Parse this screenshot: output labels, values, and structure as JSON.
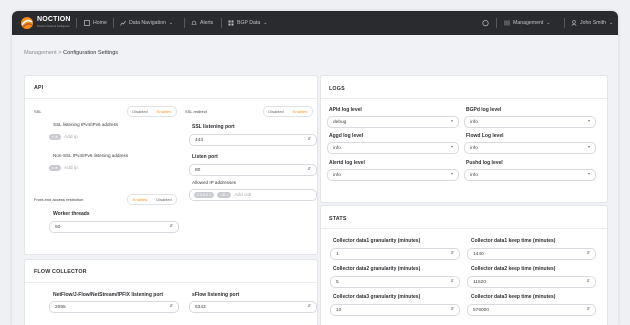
{
  "brand": {
    "name": "NOCTION",
    "tagline": "Noction Network Intelligence"
  },
  "nav": {
    "home": "Home",
    "data_navigation": "Data Navigation",
    "alerts": "Alerts",
    "bgp_data": "BGP Data",
    "management": "Management",
    "user": "John Smith"
  },
  "breadcrumb": {
    "parent": "Management",
    "separator": ">",
    "current": "Configuration Settings"
  },
  "api": {
    "title": "API",
    "ssl_label": "SSL",
    "ssl_off": "Disabled",
    "ssl_on": "Enabled",
    "ssl_redirect_label": "SSL redirect",
    "redirect_off": "Disabled",
    "redirect_on": "Enabled",
    "ssl_listen_label": "SSL listening IPv4/IPv6 address",
    "ssl_listen_chip": "x ★",
    "ssl_listen_placeholder": "Add ip",
    "ssl_port_label": "SSL listening port",
    "ssl_port_value": "443",
    "nonssl_listen_label": "Non-SSL IPv4/IPv6 listening address",
    "nonssl_listen_chip": "x ★",
    "nonssl_listen_placeholder": "Add ip",
    "listen_port_label": "Listen port",
    "listen_port_value": "80",
    "allowed_label": "Allowed IP addresses",
    "allowed_chip1": "0.0.0.0 ×",
    "allowed_chip2": "::/0 ×",
    "allowed_placeholder": "Add cidr",
    "frontend_label": "Front-end access restriction",
    "frontend_on": "Enabled",
    "frontend_off": "Disabled",
    "workers_label": "Worker threads",
    "workers_value": "50"
  },
  "flow": {
    "title": "FLOW COLLECTOR",
    "netflow_label": "NetFlow/J-Flow/NetStream/IPFIX listening port",
    "netflow_value": "2055",
    "sflow_label": "sFlow listening port",
    "sflow_value": "6343"
  },
  "logs": {
    "title": "LOGS",
    "apid_label": "APId log level",
    "apid_value": "debug",
    "bgpd_label": "BGPd log level",
    "bgpd_value": "info",
    "aggd_label": "Aggd log level",
    "aggd_value": "info",
    "flowd_label": "Flowd Log level",
    "flowd_value": "info",
    "alertd_label": "Alertd log level",
    "alertd_value": "info",
    "pushd_label": "Pushd log level",
    "pushd_value": "info"
  },
  "stats": {
    "title": "STATS",
    "c1_gran_label": "Collector data1 granularity (minutes)",
    "c1_gran_value": "1",
    "c1_keep_label": "Collector data1 keep time (minutes)",
    "c1_keep_value": "1440",
    "c2_gran_label": "Collector data2 granularity (minutes)",
    "c2_gran_value": "5",
    "c2_keep_label": "Collector data2 keep time (minutes)",
    "c2_keep_value": "11520",
    "c3_gran_label": "Collector data3 granularity (minutes)",
    "c3_gran_value": "10",
    "c3_keep_label": "Collector data3 keep time (minutes)",
    "c3_keep_value": "576000"
  },
  "icons": {
    "stepper": "stepper-icon",
    "dropdown": "dropdown-caret-icon"
  },
  "colors": {
    "accent": "#f39a1f",
    "topbar": "#2a2b2f",
    "background": "#f1f2f5"
  }
}
